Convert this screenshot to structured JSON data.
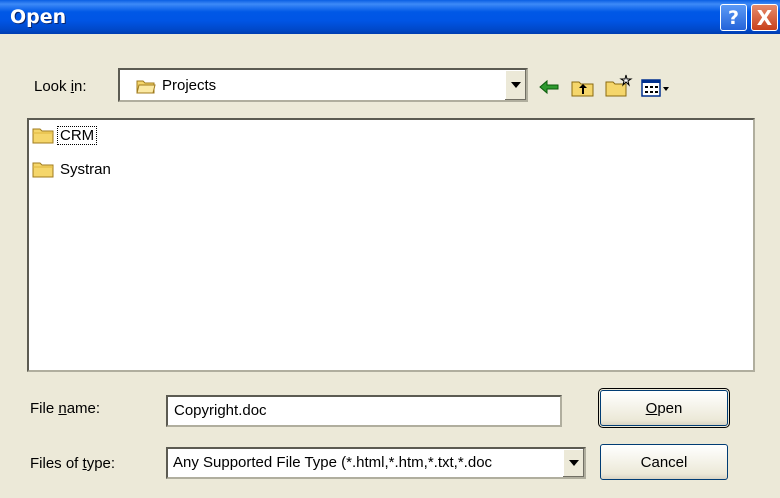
{
  "window": {
    "title": "Open"
  },
  "titlebar": {
    "help_label": "?",
    "close_label": "X"
  },
  "lookin": {
    "label_prefix": "Look ",
    "label_accel": "i",
    "label_suffix": "n:",
    "value": "Projects"
  },
  "toolbar": {
    "icons": [
      "back-icon",
      "up-one-level-icon",
      "new-folder-icon",
      "views-menu-icon"
    ]
  },
  "files": [
    {
      "name": "CRM",
      "type": "folder",
      "focused": true
    },
    {
      "name": "Systran",
      "type": "folder",
      "focused": false
    }
  ],
  "filename": {
    "label_prefix": "File ",
    "label_accel": "n",
    "label_suffix": "ame:",
    "value": "Copyright.doc"
  },
  "filetype": {
    "label_prefix": "Files of ",
    "label_accel": "t",
    "label_suffix": "ype:",
    "value": "Any Supported File Type (*.html,*.htm,*.txt,*.doc"
  },
  "buttons": {
    "open_accel": "O",
    "open_rest": "pen",
    "cancel": "Cancel"
  },
  "colors": {
    "titlebar": "#0055e5",
    "dialog_bg": "#ece9d8",
    "folder_yellow": "#f5d66b"
  }
}
